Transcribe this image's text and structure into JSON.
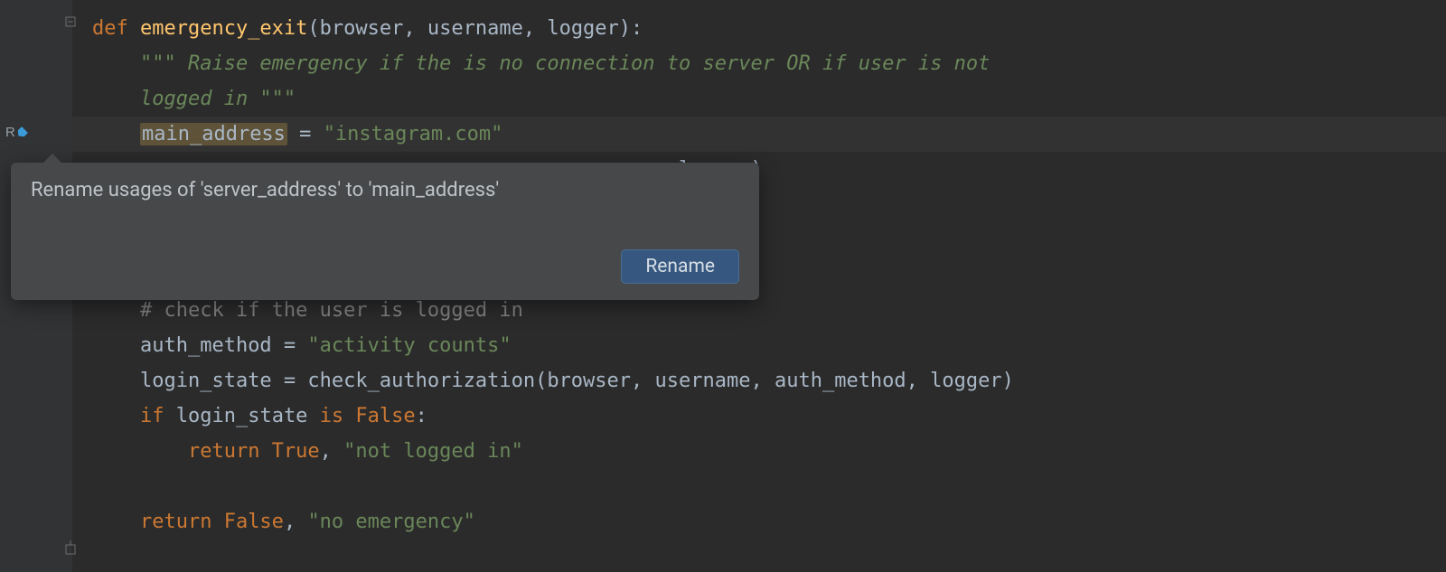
{
  "code": {
    "line1": {
      "kw": "def ",
      "fn": "emergency_exit",
      "params": "(browser, username, logger):"
    },
    "line2": {
      "doc": "\"\"\" Raise emergency if the is no connection to server OR if user is not"
    },
    "line3": {
      "doc": "logged in \"\"\""
    },
    "line4": {
      "var": "main_address",
      "rest": " = ",
      "str": "\"instagram.com\""
    },
    "line5": {
      "behind_popup": ", logger)"
    },
    "line9": {
      "cmt": "# check if the user is logged in"
    },
    "line10": {
      "lhs": "auth_method = ",
      "str": "\"activity counts\""
    },
    "line11": {
      "txt": "login_state = check_authorization(browser, username, auth_method, logger)"
    },
    "line12": {
      "kw_if": "if ",
      "mid": "login_state ",
      "kw_is": "is False",
      "colon": ":"
    },
    "line13": {
      "kw_return": "return True",
      "comma": ", ",
      "str": "\"not logged in\""
    },
    "line15": {
      "kw_return": "return False",
      "comma": ", ",
      "str": "\"no emergency\""
    }
  },
  "popup": {
    "message": "Rename usages of 'server_address' to 'main_address'",
    "button": "Rename"
  },
  "gutter": {
    "rename_marker": "R"
  }
}
